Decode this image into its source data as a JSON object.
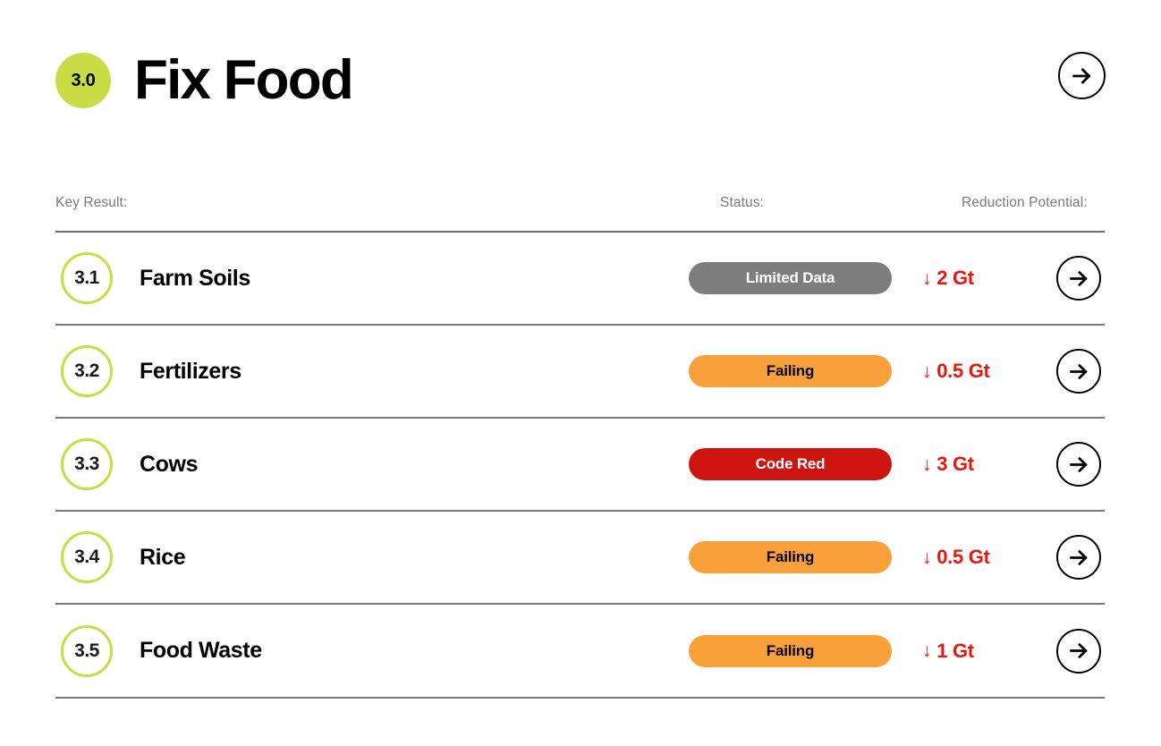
{
  "header": {
    "number": "3.0",
    "title": "Fix Food",
    "badge_color": "#c8dc46",
    "next_arrow_icon": "arrow-right-icon"
  },
  "columns": {
    "key_result": "Key Result:",
    "status": "Status:",
    "reduction_potential": "Reduction Potential:"
  },
  "status_colors": {
    "limited_data_bg": "#7d7d7d",
    "limited_data_text": "#ffffff",
    "failing_bg": "#f9a03a",
    "failing_text": "#000000",
    "code_red_bg": "#cc1511",
    "code_red_text": "#ffffff",
    "reduction_text": "#e8170f"
  },
  "rows": [
    {
      "number": "3.1",
      "name": "Farm Soils",
      "status": "Limited Data",
      "status_type": "limited",
      "reduction_arrow": "↓",
      "reduction": "2 Gt",
      "arrow_icon": "arrow-right-icon"
    },
    {
      "number": "3.2",
      "name": "Fertilizers",
      "status": "Failing",
      "status_type": "failing",
      "reduction_arrow": "↓",
      "reduction": "0.5 Gt",
      "arrow_icon": "arrow-right-icon"
    },
    {
      "number": "3.3",
      "name": "Cows",
      "status": "Code Red",
      "status_type": "codered",
      "reduction_arrow": "↓",
      "reduction": "3 Gt",
      "arrow_icon": "arrow-right-icon"
    },
    {
      "number": "3.4",
      "name": "Rice",
      "status": "Failing",
      "status_type": "failing",
      "reduction_arrow": "↓",
      "reduction": "0.5 Gt",
      "arrow_icon": "arrow-right-icon"
    },
    {
      "number": "3.5",
      "name": "Food Waste",
      "status": "Failing",
      "status_type": "failing",
      "reduction_arrow": "↓",
      "reduction": "1 Gt",
      "arrow_icon": "arrow-right-icon"
    }
  ]
}
